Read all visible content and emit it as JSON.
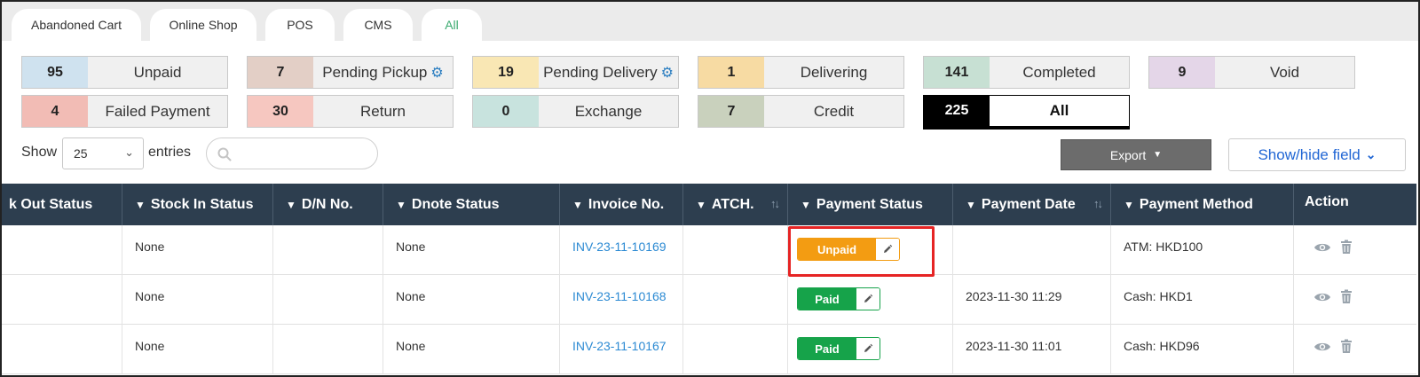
{
  "tabs": [
    {
      "label": "Abandoned Cart",
      "active": false
    },
    {
      "label": "Online Shop",
      "active": false
    },
    {
      "label": "POS",
      "active": false
    },
    {
      "label": "CMS",
      "active": false
    },
    {
      "label": "All",
      "active": true
    }
  ],
  "status_cards": [
    {
      "count": "95",
      "label": "Unpaid",
      "color": "#cfe2ef",
      "gear": false
    },
    {
      "count": "7",
      "label": "Pending Pickup",
      "color": "#e3cfc6",
      "gear": true
    },
    {
      "count": "19",
      "label": "Pending Delivery",
      "color": "#f9e7b4",
      "gear": true
    },
    {
      "count": "1",
      "label": "Delivering",
      "color": "#f7dba3",
      "gear": false
    },
    {
      "count": "141",
      "label": "Completed",
      "color": "#c7e0d3",
      "gear": false
    },
    {
      "count": "9",
      "label": "Void",
      "color": "#e4d6e8",
      "gear": false
    },
    {
      "count": "4",
      "label": "Failed Payment",
      "color": "#f2bcb5",
      "gear": false
    },
    {
      "count": "30",
      "label": "Return",
      "color": "#f6c7c0",
      "gear": false
    },
    {
      "count": "0",
      "label": "Exchange",
      "color": "#c8e3de",
      "gear": false
    },
    {
      "count": "7",
      "label": "Credit",
      "color": "#c9d1bd",
      "gear": false
    },
    {
      "count": "225",
      "label": "All",
      "color": "#000000",
      "gear": false
    }
  ],
  "controls": {
    "show_label": "Show",
    "entries_value": "25",
    "entries_label": "entries",
    "search_placeholder": "",
    "export_label": "Export",
    "show_hide_label": "Show/hide field"
  },
  "table": {
    "columns": [
      {
        "label": "k Out Status",
        "filter": false,
        "sortable": false
      },
      {
        "label": "Stock In Status",
        "filter": true,
        "sortable": false
      },
      {
        "label": "D/N No.",
        "filter": true,
        "sortable": false
      },
      {
        "label": "Dnote Status",
        "filter": true,
        "sortable": false
      },
      {
        "label": "Invoice No.",
        "filter": true,
        "sortable": false
      },
      {
        "label": "ATCH.",
        "filter": true,
        "sortable": true
      },
      {
        "label": "Payment Status",
        "filter": true,
        "sortable": false
      },
      {
        "label": "Payment Date",
        "filter": true,
        "sortable": true
      },
      {
        "label": "Payment Method",
        "filter": true,
        "sortable": false
      },
      {
        "label": "Action",
        "filter": false,
        "sortable": false
      }
    ],
    "rows": [
      {
        "stock_out": "",
        "stock_in": "None",
        "dn_no": "",
        "dnote": "None",
        "invoice": "INV-23-11-10169",
        "atch": "",
        "payment_status": "Unpaid",
        "payment_date": "",
        "payment_method": "ATM: HKD100"
      },
      {
        "stock_out": "",
        "stock_in": "None",
        "dn_no": "",
        "dnote": "None",
        "invoice": "INV-23-11-10168",
        "atch": "",
        "payment_status": "Paid",
        "payment_date": "2023-11-30 11:29",
        "payment_method": "Cash: HKD1"
      },
      {
        "stock_out": "",
        "stock_in": "None",
        "dn_no": "",
        "dnote": "None",
        "invoice": "INV-23-11-10167",
        "atch": "",
        "payment_status": "Paid",
        "payment_date": "2023-11-30 11:01",
        "payment_method": "Cash: HKD96"
      }
    ]
  },
  "colors": {
    "header_bg": "#2d3e4f",
    "unpaid": "#f39c12",
    "paid": "#16a34a",
    "link": "#2c8ad3",
    "accent_tab": "#3aaa6f"
  }
}
